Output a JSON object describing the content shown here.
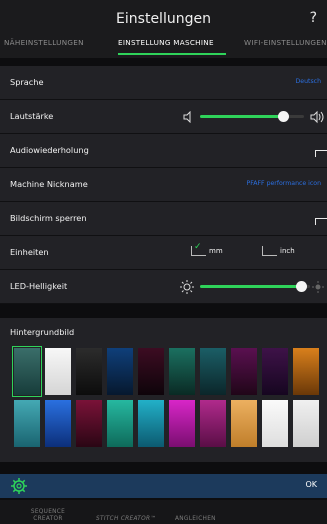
{
  "header": {
    "title": "Einstellungen",
    "help_label": "?",
    "tabs": [
      "NÄHEINSTELLUNGEN",
      "EINSTELLUNG MASCHINE",
      "WIFI-EINSTELLUNGEN"
    ],
    "active_tab": "EINSTELLUNG MASCHINE"
  },
  "settings": {
    "language": {
      "label": "Sprache",
      "value": "Deutsch"
    },
    "volume": {
      "label": "Lautstärke",
      "level": 0.8
    },
    "audio_repeat": {
      "label": "Audiowiederholung"
    },
    "nickname": {
      "label": "Machine Nickname",
      "value": "PFAFF performance icon"
    },
    "screen_lock": {
      "label": "Bildschirm sperren"
    },
    "units": {
      "label": "Einheiten",
      "options": [
        "mm",
        "inch"
      ],
      "selected": "mm"
    },
    "led": {
      "label": "LED-Helligkeit",
      "level": 0.92
    }
  },
  "background": {
    "label": "Hintergrundbild",
    "selected_index": 0
  },
  "footer": {
    "ok_label": "OK"
  },
  "bottom_tabs": [
    "SEQUENCE CREATOR",
    "STITCH CREATOR™",
    "ANGLEICHEN"
  ],
  "colors": {
    "accent": "#2fd35a",
    "link": "#2b6fe0",
    "footer_bar": "#1c3a5c"
  }
}
